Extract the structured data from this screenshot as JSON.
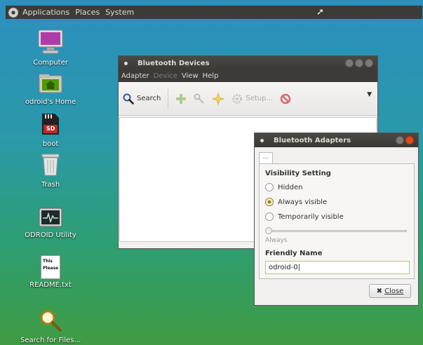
{
  "panel": {
    "menus": [
      "Applications",
      "Places",
      "System"
    ]
  },
  "desktop": {
    "icons": [
      {
        "label": "Computer",
        "icon": "computer-icon"
      },
      {
        "label": "odroid's Home",
        "icon": "home-folder-icon"
      },
      {
        "label": "boot",
        "icon": "sd-card-icon",
        "badge": "SD"
      },
      {
        "label": "Trash",
        "icon": "trash-icon"
      },
      {
        "label": "ODROID Utility",
        "icon": "utility-monitor-icon"
      },
      {
        "label": "README.txt",
        "icon": "text-file-icon",
        "preview": "This\nPlease"
      },
      {
        "label": "Search for Files...",
        "icon": "search-files-icon"
      }
    ]
  },
  "devices_window": {
    "title": "Bluetooth Devices",
    "menu": {
      "adapter": "Adapter",
      "device": "Device",
      "view": "View",
      "help": "Help"
    },
    "toolbar": {
      "search": "Search",
      "setup": "Setup..."
    }
  },
  "adapters_window": {
    "title": "Bluetooth Adapters",
    "tab": "...",
    "visibility_heading": "Visibility Setting",
    "options": {
      "hidden": "Hidden",
      "always": "Always visible",
      "temporary": "Temporarily visible"
    },
    "selected": "always",
    "slider_caption": "Always",
    "friendly_heading": "Friendly Name",
    "friendly_value": "odroid-0",
    "close_label": "Close"
  },
  "colors": {
    "panel_bg": "#3c3b37",
    "close_button": "#df4a16",
    "accent": "#f7e28d"
  }
}
